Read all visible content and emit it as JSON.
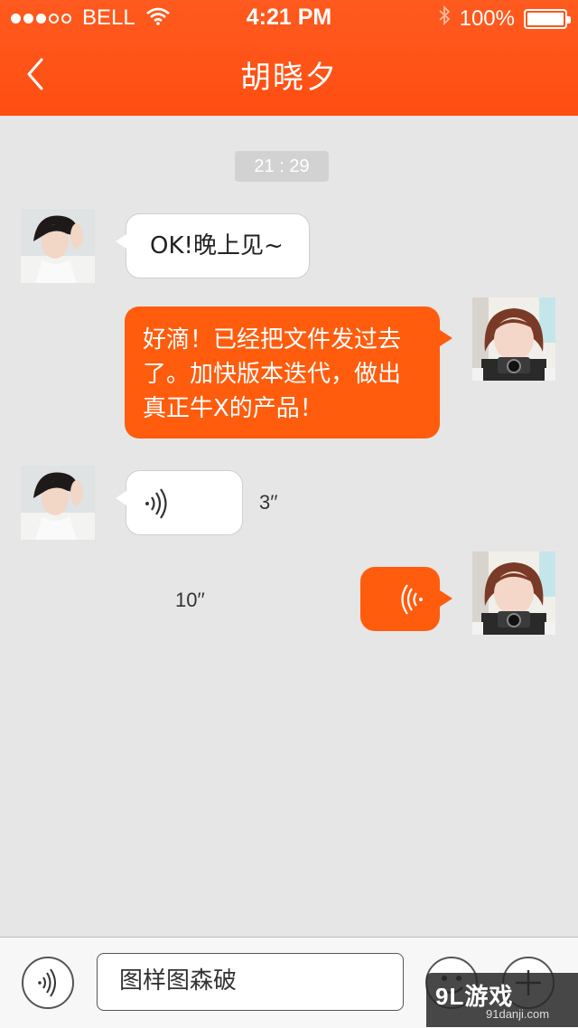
{
  "status_bar": {
    "carrier": "BELL",
    "time": "4:21 PM",
    "battery": "100%",
    "signal_bars": 3,
    "signal_total": 5
  },
  "header": {
    "title": "胡晓夕",
    "back_icon": "chevron-left-icon"
  },
  "chat": {
    "timestamp": "21 : 29",
    "messages": [
      {
        "from": "contact",
        "type": "text",
        "text": "OK!晚上见~"
      },
      {
        "from": "me",
        "type": "text",
        "lines": [
          "好滴！已经把文件发过去",
          "了。加快版本迭代，做出",
          "真正牛X的产品！"
        ]
      },
      {
        "from": "contact",
        "type": "voice",
        "duration": "3′′"
      },
      {
        "from": "me",
        "type": "voice",
        "duration": "10′′"
      }
    ]
  },
  "input_bar": {
    "text_value": "图样图森破",
    "voice_icon": "voice-wave-icon",
    "emoji_icon": "smiley-icon",
    "plus_icon": "plus-icon"
  },
  "watermark": {
    "logo": "9L游戏",
    "url": "91danji.com"
  },
  "colors": {
    "accent": "#ff5c0e",
    "header": "#ff5a1f",
    "background": "#e6e6e6"
  }
}
